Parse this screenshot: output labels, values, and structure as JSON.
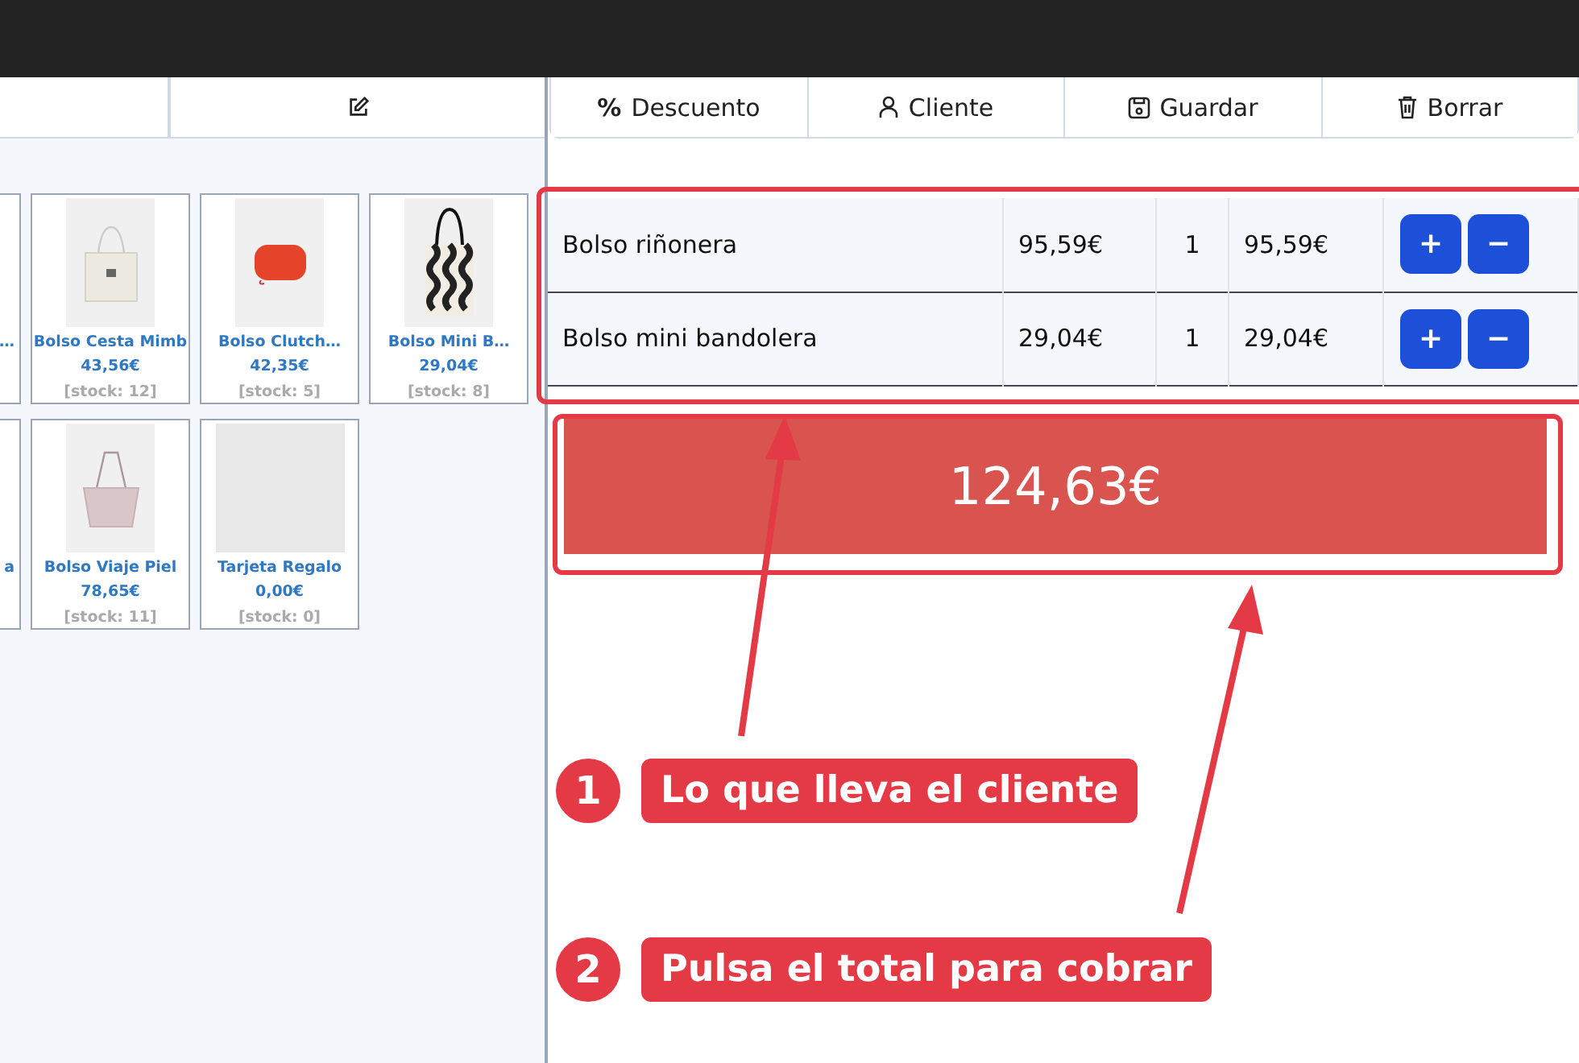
{
  "toolbar": [
    {
      "kind": "discount",
      "symbol": "%",
      "label": "Descuento"
    },
    {
      "kind": "client",
      "label": "Cliente"
    },
    {
      "kind": "save",
      "label": "Guardar"
    },
    {
      "kind": "delete",
      "label": "Borrar"
    }
  ],
  "products": [
    {
      "name": "…"
    },
    {
      "name": "Bolso Cesta Mimb",
      "price": "43,56€",
      "stock": "[stock: 12]"
    },
    {
      "name": "Bolso Clutch…",
      "price": "42,35€",
      "stock": "[stock: 5]"
    },
    {
      "name": "Bolso Mini B…",
      "price": "29,04€",
      "stock": "[stock: 8]"
    },
    {
      "name": "a"
    },
    {
      "name": "Bolso Viaje Piel",
      "price": "78,65€",
      "stock": "[stock: 11]"
    },
    {
      "name": "Tarjeta Regalo",
      "price": "0,00€",
      "stock": "[stock: 0]"
    }
  ],
  "cart": [
    {
      "name": "Bolso riñonera",
      "price": "95,59€",
      "qty": "1",
      "total": "95,59€",
      "plus": "+",
      "minus": "−"
    },
    {
      "name": "Bolso mini bandolera",
      "price": "29,04€",
      "qty": "1",
      "total": "29,04€",
      "plus": "+",
      "minus": "−"
    }
  ],
  "total": "124,63€",
  "annotations": [
    {
      "number": "1",
      "text": "Lo que lleva el cliente"
    },
    {
      "number": "2",
      "text": "Pulsa el total para cobrar"
    }
  ]
}
